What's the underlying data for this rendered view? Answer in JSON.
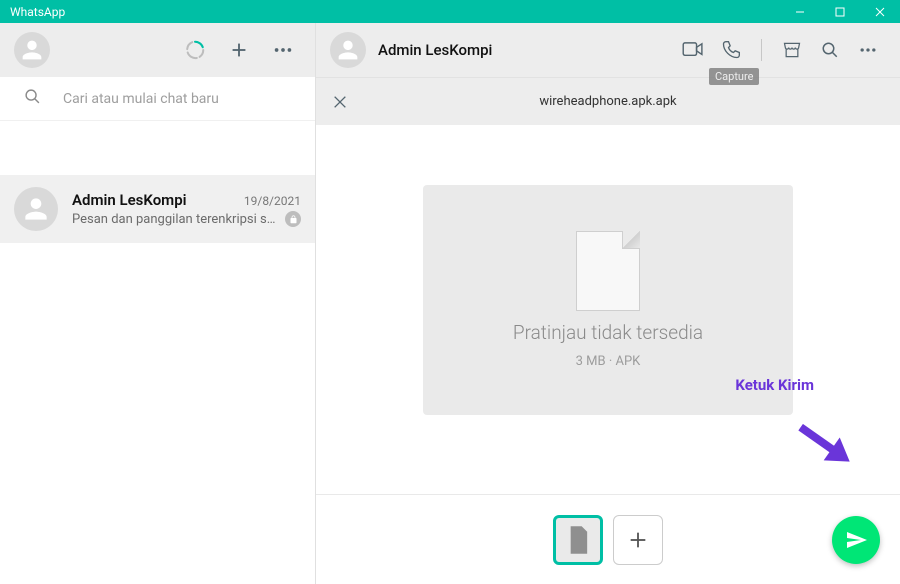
{
  "titlebar": {
    "app_name": "WhatsApp"
  },
  "left": {
    "search_placeholder": "Cari atau mulai chat baru",
    "chat": {
      "name": "Admin LesKompi",
      "date": "19/8/2021",
      "preview": "Pesan dan panggilan terenkripsi secara ..."
    }
  },
  "right": {
    "contact_name": "Admin LesKompi",
    "tooltip": "Capture",
    "file_name": "wireheadphone.apk.apk",
    "preview_label": "Pratinjau tidak tersedia",
    "file_meta": "3 MB · APK"
  },
  "annotation": {
    "label": "Ketuk Kirim"
  }
}
